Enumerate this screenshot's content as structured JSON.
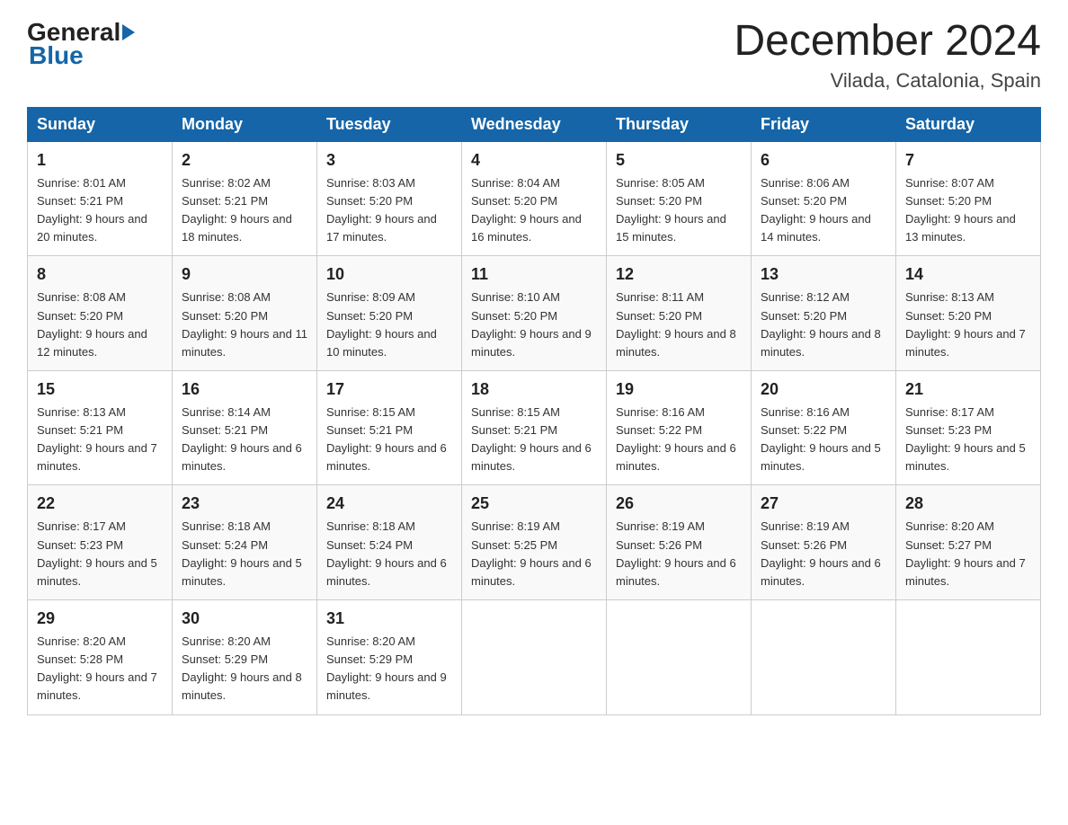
{
  "header": {
    "logo_general": "General",
    "logo_blue": "Blue",
    "month_title": "December 2024",
    "location": "Vilada, Catalonia, Spain"
  },
  "weekdays": [
    "Sunday",
    "Monday",
    "Tuesday",
    "Wednesday",
    "Thursday",
    "Friday",
    "Saturday"
  ],
  "weeks": [
    [
      {
        "day": "1",
        "sunrise": "Sunrise: 8:01 AM",
        "sunset": "Sunset: 5:21 PM",
        "daylight": "Daylight: 9 hours and 20 minutes."
      },
      {
        "day": "2",
        "sunrise": "Sunrise: 8:02 AM",
        "sunset": "Sunset: 5:21 PM",
        "daylight": "Daylight: 9 hours and 18 minutes."
      },
      {
        "day": "3",
        "sunrise": "Sunrise: 8:03 AM",
        "sunset": "Sunset: 5:20 PM",
        "daylight": "Daylight: 9 hours and 17 minutes."
      },
      {
        "day": "4",
        "sunrise": "Sunrise: 8:04 AM",
        "sunset": "Sunset: 5:20 PM",
        "daylight": "Daylight: 9 hours and 16 minutes."
      },
      {
        "day": "5",
        "sunrise": "Sunrise: 8:05 AM",
        "sunset": "Sunset: 5:20 PM",
        "daylight": "Daylight: 9 hours and 15 minutes."
      },
      {
        "day": "6",
        "sunrise": "Sunrise: 8:06 AM",
        "sunset": "Sunset: 5:20 PM",
        "daylight": "Daylight: 9 hours and 14 minutes."
      },
      {
        "day": "7",
        "sunrise": "Sunrise: 8:07 AM",
        "sunset": "Sunset: 5:20 PM",
        "daylight": "Daylight: 9 hours and 13 minutes."
      }
    ],
    [
      {
        "day": "8",
        "sunrise": "Sunrise: 8:08 AM",
        "sunset": "Sunset: 5:20 PM",
        "daylight": "Daylight: 9 hours and 12 minutes."
      },
      {
        "day": "9",
        "sunrise": "Sunrise: 8:08 AM",
        "sunset": "Sunset: 5:20 PM",
        "daylight": "Daylight: 9 hours and 11 minutes."
      },
      {
        "day": "10",
        "sunrise": "Sunrise: 8:09 AM",
        "sunset": "Sunset: 5:20 PM",
        "daylight": "Daylight: 9 hours and 10 minutes."
      },
      {
        "day": "11",
        "sunrise": "Sunrise: 8:10 AM",
        "sunset": "Sunset: 5:20 PM",
        "daylight": "Daylight: 9 hours and 9 minutes."
      },
      {
        "day": "12",
        "sunrise": "Sunrise: 8:11 AM",
        "sunset": "Sunset: 5:20 PM",
        "daylight": "Daylight: 9 hours and 8 minutes."
      },
      {
        "day": "13",
        "sunrise": "Sunrise: 8:12 AM",
        "sunset": "Sunset: 5:20 PM",
        "daylight": "Daylight: 9 hours and 8 minutes."
      },
      {
        "day": "14",
        "sunrise": "Sunrise: 8:13 AM",
        "sunset": "Sunset: 5:20 PM",
        "daylight": "Daylight: 9 hours and 7 minutes."
      }
    ],
    [
      {
        "day": "15",
        "sunrise": "Sunrise: 8:13 AM",
        "sunset": "Sunset: 5:21 PM",
        "daylight": "Daylight: 9 hours and 7 minutes."
      },
      {
        "day": "16",
        "sunrise": "Sunrise: 8:14 AM",
        "sunset": "Sunset: 5:21 PM",
        "daylight": "Daylight: 9 hours and 6 minutes."
      },
      {
        "day": "17",
        "sunrise": "Sunrise: 8:15 AM",
        "sunset": "Sunset: 5:21 PM",
        "daylight": "Daylight: 9 hours and 6 minutes."
      },
      {
        "day": "18",
        "sunrise": "Sunrise: 8:15 AM",
        "sunset": "Sunset: 5:21 PM",
        "daylight": "Daylight: 9 hours and 6 minutes."
      },
      {
        "day": "19",
        "sunrise": "Sunrise: 8:16 AM",
        "sunset": "Sunset: 5:22 PM",
        "daylight": "Daylight: 9 hours and 6 minutes."
      },
      {
        "day": "20",
        "sunrise": "Sunrise: 8:16 AM",
        "sunset": "Sunset: 5:22 PM",
        "daylight": "Daylight: 9 hours and 5 minutes."
      },
      {
        "day": "21",
        "sunrise": "Sunrise: 8:17 AM",
        "sunset": "Sunset: 5:23 PM",
        "daylight": "Daylight: 9 hours and 5 minutes."
      }
    ],
    [
      {
        "day": "22",
        "sunrise": "Sunrise: 8:17 AM",
        "sunset": "Sunset: 5:23 PM",
        "daylight": "Daylight: 9 hours and 5 minutes."
      },
      {
        "day": "23",
        "sunrise": "Sunrise: 8:18 AM",
        "sunset": "Sunset: 5:24 PM",
        "daylight": "Daylight: 9 hours and 5 minutes."
      },
      {
        "day": "24",
        "sunrise": "Sunrise: 8:18 AM",
        "sunset": "Sunset: 5:24 PM",
        "daylight": "Daylight: 9 hours and 6 minutes."
      },
      {
        "day": "25",
        "sunrise": "Sunrise: 8:19 AM",
        "sunset": "Sunset: 5:25 PM",
        "daylight": "Daylight: 9 hours and 6 minutes."
      },
      {
        "day": "26",
        "sunrise": "Sunrise: 8:19 AM",
        "sunset": "Sunset: 5:26 PM",
        "daylight": "Daylight: 9 hours and 6 minutes."
      },
      {
        "day": "27",
        "sunrise": "Sunrise: 8:19 AM",
        "sunset": "Sunset: 5:26 PM",
        "daylight": "Daylight: 9 hours and 6 minutes."
      },
      {
        "day": "28",
        "sunrise": "Sunrise: 8:20 AM",
        "sunset": "Sunset: 5:27 PM",
        "daylight": "Daylight: 9 hours and 7 minutes."
      }
    ],
    [
      {
        "day": "29",
        "sunrise": "Sunrise: 8:20 AM",
        "sunset": "Sunset: 5:28 PM",
        "daylight": "Daylight: 9 hours and 7 minutes."
      },
      {
        "day": "30",
        "sunrise": "Sunrise: 8:20 AM",
        "sunset": "Sunset: 5:29 PM",
        "daylight": "Daylight: 9 hours and 8 minutes."
      },
      {
        "day": "31",
        "sunrise": "Sunrise: 8:20 AM",
        "sunset": "Sunset: 5:29 PM",
        "daylight": "Daylight: 9 hours and 9 minutes."
      },
      null,
      null,
      null,
      null
    ]
  ]
}
